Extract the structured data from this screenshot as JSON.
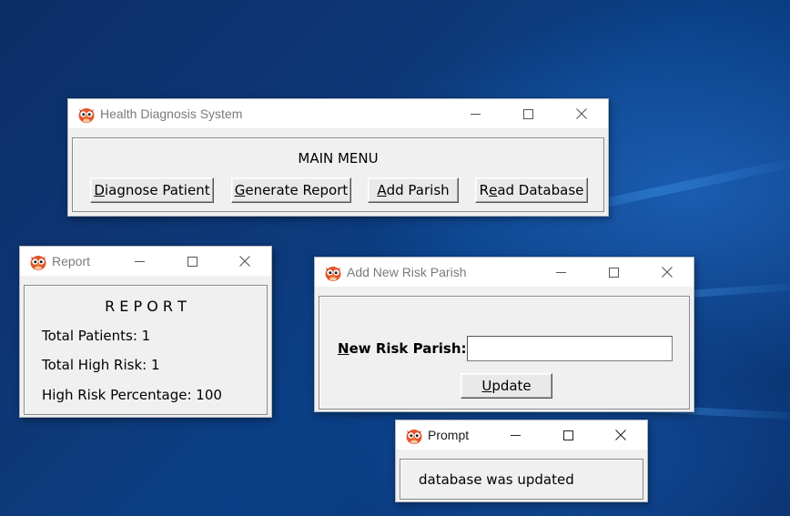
{
  "main_window": {
    "title": "Health Diagnosis System",
    "heading": "MAIN MENU",
    "buttons": {
      "diagnose": {
        "mnemonic": "D",
        "rest": "iagnose Patient"
      },
      "report": {
        "mnemonic": "G",
        "rest": "enerate Report"
      },
      "parish": {
        "mnemonic": "A",
        "rest": "dd Parish"
      },
      "read_pre": "R",
      "read_mnemonic": "e",
      "read_rest": "ad Database"
    }
  },
  "report_window": {
    "title": "Report",
    "heading": "R E P O R T",
    "lines": [
      "Total Patients: 1",
      "Total High Risk: 1",
      "High Risk Percentage: 100"
    ]
  },
  "parish_window": {
    "title": "Add New Risk Parish",
    "field_label_mnemonic": "N",
    "field_label_rest": "ew Risk Parish:",
    "field_value": "",
    "update_mnemonic": "U",
    "update_rest": "pdate"
  },
  "prompt_window": {
    "title": "Prompt",
    "message": "database was updated"
  },
  "icons": {
    "app": "owl-icon",
    "minimize": "minimize-icon",
    "maximize": "maximize-icon",
    "close": "close-icon"
  }
}
